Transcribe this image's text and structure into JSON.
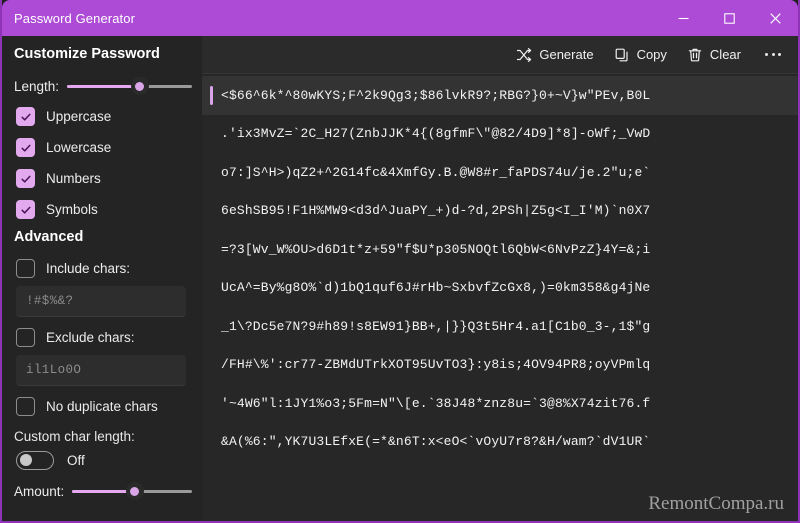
{
  "window": {
    "title": "Password Generator",
    "accent_color": "#ad4ad6",
    "controls": [
      {
        "name": "minimize",
        "glyph": "minimize-icon"
      },
      {
        "name": "maximize",
        "glyph": "maximize-icon"
      },
      {
        "name": "close",
        "glyph": "close-icon"
      }
    ]
  },
  "sidebar": {
    "heading": "Customize Password",
    "length": {
      "label": "Length:",
      "percent": 58
    },
    "options": [
      {
        "label": "Uppercase",
        "checked": true
      },
      {
        "label": "Lowercase",
        "checked": true
      },
      {
        "label": "Numbers",
        "checked": true
      },
      {
        "label": "Symbols",
        "checked": true
      }
    ],
    "advanced": {
      "heading": "Advanced",
      "include": {
        "label": "Include chars:",
        "checked": false,
        "value": "",
        "placeholder": "!#$%&?"
      },
      "exclude": {
        "label": "Exclude chars:",
        "checked": false,
        "value": "",
        "placeholder": "il1Lo0O"
      },
      "no_duplicate": {
        "label": "No duplicate chars",
        "checked": false
      }
    },
    "custom_char_length": {
      "label": "Custom char length:",
      "toggle_state": "Off",
      "toggle_on": false
    },
    "amount": {
      "label": "Amount:",
      "percent": 52
    }
  },
  "toolbar": {
    "generate_label": "Generate",
    "copy_label": "Copy",
    "clear_label": "Clear",
    "more_label": "..."
  },
  "output": {
    "lines": [
      "<$66^6k*^80wKYS;F^2k9Qg3;$86lvkR9?;RBG?}0+~V}w\"PEv,B0L",
      ".'ix3MvZ=`2C_H27(ZnbJJK*4{(8gfmF\\\"@82/4D9]*8]-oWf;_VwD",
      "o7:]S^H>)qZ2+^2G14fc&4XmfGy.B.@W8#r_faPDS74u/je.2\"u;e`",
      "6eShSB95!F1H%MW9<d3d^JuaPY_+)d-?d,2PSh|Z5g<I_I'M)`n0X7",
      "=?3[Wv_W%OU>d6D1t*z+59\"f$U*p305NOQtl6QbW<6NvPzZ}4Y=&;i",
      "UcA^=By%g8O%`d)1bQ1quf6J#rHb~SxbvfZcGx8,)=0km358&g4jNe",
      "_1\\?Dc5e7N?9#h89!s8EW91}BB+,|}}Q3t5Hr4.a1[C1b0_3-,1$\"g",
      "/FH#\\%':cr77-ZBMdUTrkXOT95UvTO3}:y8is;4OV94PR8;oyVPmlq",
      "'~4W6\"l:1JY1%o3;5Fm=N\"\\[e.`38J48*znz8u=`3@8%X74zit76.f",
      "&A(%6:\",YK7U3LEfxE(=*&n6T:x<eO<`vOyU7r8?&H/wam?`dV1UR`"
    ]
  },
  "watermark": {
    "text": "RemontCompa.ru"
  }
}
